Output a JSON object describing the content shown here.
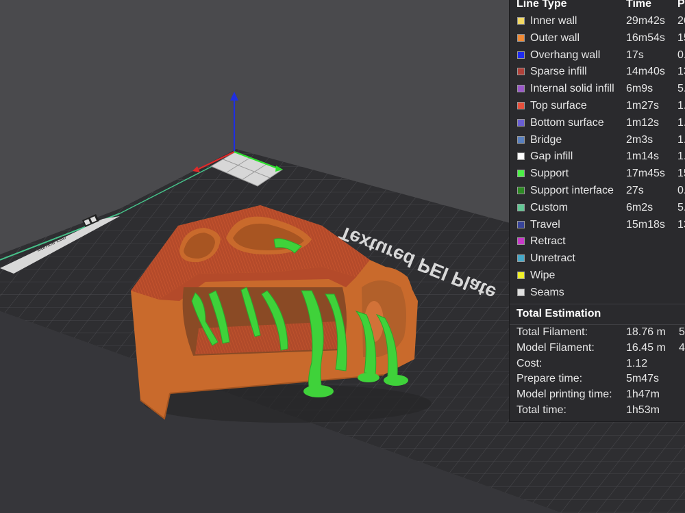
{
  "viewport": {
    "plate_label": "Textured PEI Plate",
    "plate_small_label": "Bambu Lab",
    "plate_icon": "qr-code-icon"
  },
  "legend": {
    "headers": {
      "line_type": "Line Type",
      "time": "Time",
      "percent": "P"
    },
    "items": [
      {
        "name": "Inner wall",
        "time": "29m42s",
        "pct": "26",
        "color": "#f2d865"
      },
      {
        "name": "Outer wall",
        "time": "16m54s",
        "pct": "15",
        "color": "#f08a36"
      },
      {
        "name": "Overhang wall",
        "time": "17s",
        "pct": "0.",
        "color": "#1f2cf0"
      },
      {
        "name": "Sparse infill",
        "time": "14m40s",
        "pct": "13",
        "color": "#b0413a"
      },
      {
        "name": "Internal solid infill",
        "time": "6m9s",
        "pct": "5.",
        "color": "#9a58c9"
      },
      {
        "name": "Top surface",
        "time": "1m27s",
        "pct": "1.",
        "color": "#e8503c"
      },
      {
        "name": "Bottom surface",
        "time": "1m12s",
        "pct": "1.",
        "color": "#6a5fd3"
      },
      {
        "name": "Bridge",
        "time": "2m3s",
        "pct": "1.",
        "color": "#5a80bf"
      },
      {
        "name": "Gap infill",
        "time": "1m14s",
        "pct": "1.",
        "color": "#ffffff"
      },
      {
        "name": "Support",
        "time": "17m45s",
        "pct": "15",
        "color": "#4cf046"
      },
      {
        "name": "Support interface",
        "time": "27s",
        "pct": "0.",
        "color": "#2d8a24"
      },
      {
        "name": "Custom",
        "time": "6m2s",
        "pct": "5.",
        "color": "#63c895"
      },
      {
        "name": "Travel",
        "time": "15m18s",
        "pct": "13",
        "color": "#38449a"
      },
      {
        "name": "Retract",
        "time": "",
        "pct": "",
        "color": "#c83ac8"
      },
      {
        "name": "Unretract",
        "time": "",
        "pct": "",
        "color": "#46a8c8"
      },
      {
        "name": "Wipe",
        "time": "",
        "pct": "",
        "color": "#f0f028"
      },
      {
        "name": "Seams",
        "time": "",
        "pct": "",
        "color": "#e0e0e0"
      }
    ]
  },
  "estimation": {
    "title": "Total Estimation",
    "rows": [
      {
        "label": "Total Filament:",
        "value": "18.76 m",
        "extra": "5"
      },
      {
        "label": "Model Filament:",
        "value": "16.45 m",
        "extra": "4"
      },
      {
        "label": "Cost:",
        "value": "1.12",
        "extra": ""
      },
      {
        "label": "Prepare time:",
        "value": "5m47s",
        "extra": ""
      },
      {
        "label": "Model printing time:",
        "value": "1h47m",
        "extra": ""
      },
      {
        "label": "Total time:",
        "value": "1h53m",
        "extra": ""
      }
    ]
  }
}
